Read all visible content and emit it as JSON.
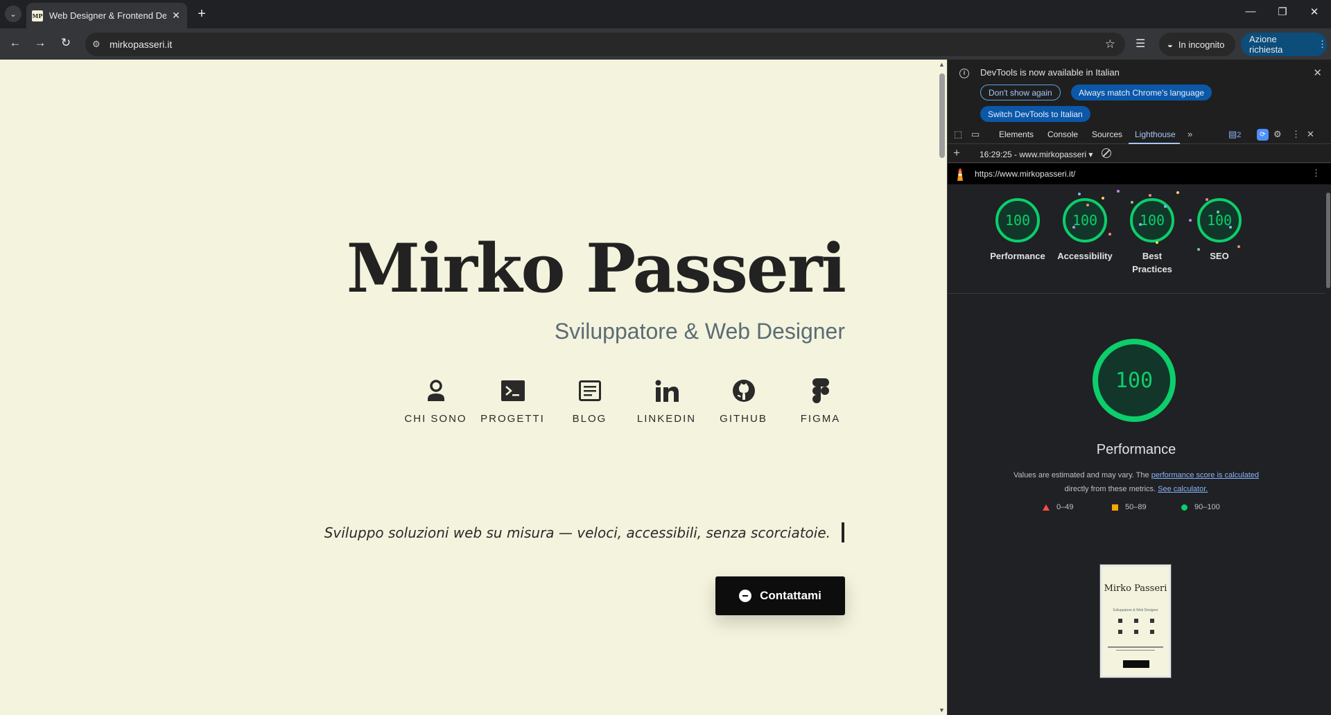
{
  "browser": {
    "tab_title": "Web Designer & Frontend Developer",
    "favicon_text": "MP",
    "url": "mirkopasseri.it",
    "incognito_label": "In incognito",
    "action_label": "Azione richiesta"
  },
  "page": {
    "name": "Mirko Passeri",
    "subtitle": "Sviluppatore & Web Designer",
    "links": [
      {
        "label": "CHI SONO",
        "icon": "person-icon"
      },
      {
        "label": "PROGETTI",
        "icon": "terminal-icon"
      },
      {
        "label": "BLOG",
        "icon": "article-icon"
      },
      {
        "label": "LINKEDIN",
        "icon": "linkedin-icon"
      },
      {
        "label": "GITHUB",
        "icon": "github-icon"
      },
      {
        "label": "FIGMA",
        "icon": "figma-icon"
      }
    ],
    "tagline": "Sviluppo soluzioni web su misura — veloci, accessibili, senza scorciatoie.",
    "contact_label": "Contattami",
    "colors": {
      "background": "#f4f3dd",
      "text": "#222222",
      "subtitle": "#5a6c75",
      "button": "#0d0d0d"
    }
  },
  "devtools": {
    "infobar": {
      "message": "DevTools is now available in Italian",
      "dont_show": "Don't show again",
      "always_match": "Always match Chrome's language",
      "switch": "Switch DevTools to Italian"
    },
    "tabs": [
      "Elements",
      "Console",
      "Sources",
      "Lighthouse"
    ],
    "active_tab": "Lighthouse",
    "issues_count": "2",
    "report_label": "16:29:25 - www.mirkopasseri",
    "report_url": "https://www.mirkopasseri.it/",
    "scores": [
      {
        "label": "Performance",
        "score": "100"
      },
      {
        "label": "Accessibility",
        "score": "100"
      },
      {
        "label": "Best Practices",
        "score": "100"
      },
      {
        "label": "SEO",
        "score": "100"
      }
    ],
    "main_score": "100",
    "main_label": "Performance",
    "note_prefix": "Values are estimated and may vary. The",
    "note_link1": "performance score is calculated",
    "note_middle": "directly from these metrics.",
    "note_link2": "See calculator.",
    "legend": [
      {
        "range": "0–49",
        "color": "#ff4e42"
      },
      {
        "range": "50–89",
        "color": "#ffa400"
      },
      {
        "range": "90–100",
        "color": "#0cce6b"
      }
    ],
    "thumbnail": {
      "name": "Mirko Passeri",
      "subtitle": "Sviluppatore & Web Designer"
    },
    "accent_color": "#0cce6b"
  }
}
